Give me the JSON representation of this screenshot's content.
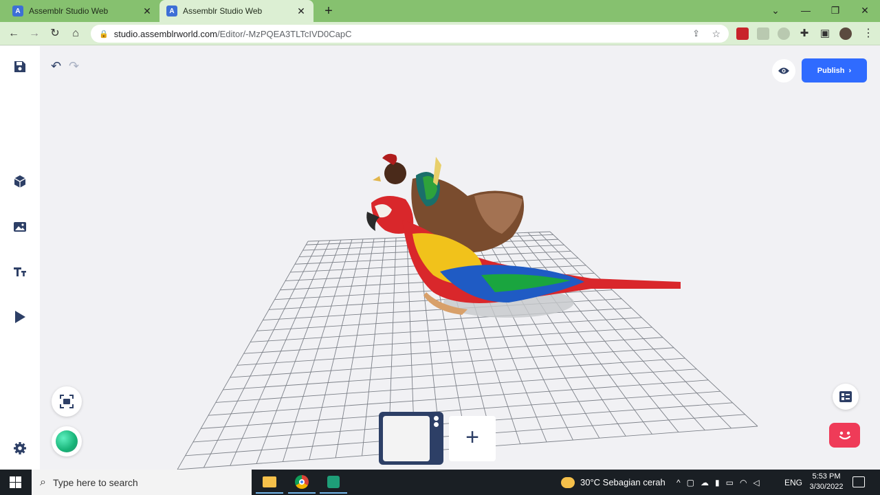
{
  "browser": {
    "tabs": [
      {
        "title": "Assemblr Studio Web",
        "active": false
      },
      {
        "title": "Assemblr Studio Web",
        "active": true
      }
    ],
    "new_tab_symbol": "+",
    "url_domain": "studio.assemblrworld.com",
    "url_path": "/Editor/-MzPQEA3TLTcIVD0CapC"
  },
  "editor": {
    "publish_label": "Publish",
    "publish_chevron": "›",
    "add_scene_symbol": "+",
    "accent_color": "#2f6bff",
    "thumb_color": "#2d3f66",
    "chat_color": "#ef3b58",
    "left_rail": [
      {
        "name": "save-icon"
      },
      {
        "name": "3d-object-icon"
      },
      {
        "name": "image-icon"
      },
      {
        "name": "text-icon"
      },
      {
        "name": "play-icon"
      },
      {
        "name": "settings-icon"
      }
    ]
  },
  "taskbar": {
    "search_placeholder": "Type here to search",
    "weather": "30°C  Sebagian cerah",
    "language": "ENG",
    "time": "5:53 PM",
    "date": "3/30/2022"
  }
}
